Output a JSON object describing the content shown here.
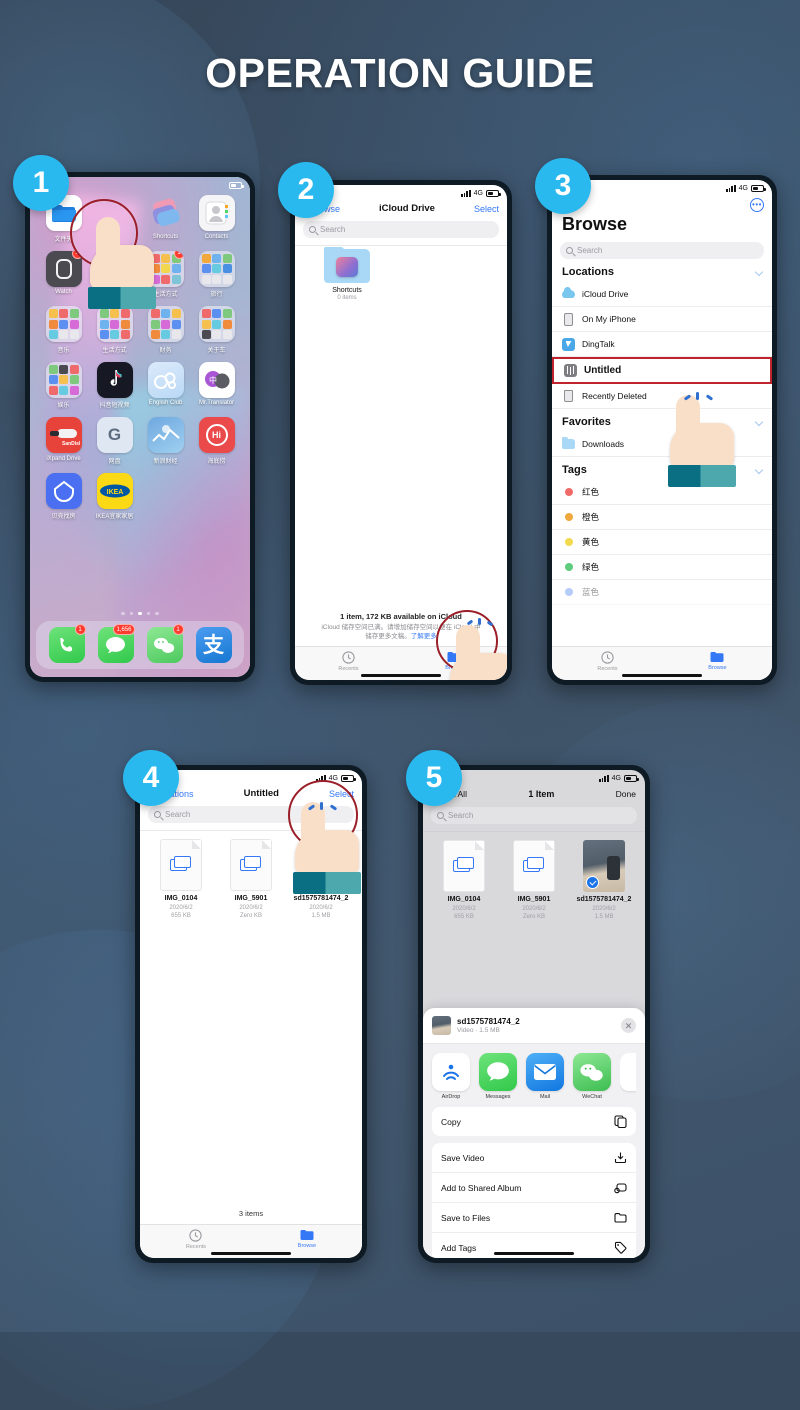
{
  "page": {
    "title": "OPERATION GUIDE",
    "accent": "#2ab9ef",
    "highlight": "#c0232b",
    "background": "#37495c"
  },
  "status_bar": {
    "network": "4G",
    "signal_icon": "signal-bars-icon",
    "battery_icon": "battery-icon"
  },
  "steps": [
    {
      "number": "1"
    },
    {
      "number": "2"
    },
    {
      "number": "3"
    },
    {
      "number": "4"
    },
    {
      "number": "5"
    }
  ],
  "step1": {
    "name": "home-screen",
    "apps": [
      {
        "label": "文件夹",
        "icon": "files-app-icon",
        "badge": ""
      },
      {
        "label": "",
        "icon": "blank",
        "badge": ""
      },
      {
        "label": "Shortcuts",
        "icon": "shortcuts-icon",
        "badge": ""
      },
      {
        "label": "Contacts",
        "icon": "contacts-icon",
        "badge": ""
      },
      {
        "label": "Watch",
        "icon": "watch-icon",
        "badge": "1"
      },
      {
        "label": "",
        "icon": "blank",
        "badge": "1"
      },
      {
        "label": "生活方式",
        "icon": "folder-icon",
        "badge": "1"
      },
      {
        "label": "旅行",
        "icon": "folder-icon",
        "badge": ""
      },
      {
        "label": "音乐",
        "icon": "folder-icon",
        "badge": ""
      },
      {
        "label": "生活方式",
        "icon": "folder-icon",
        "badge": ""
      },
      {
        "label": "财务",
        "icon": "folder-icon",
        "badge": ""
      },
      {
        "label": "关于车",
        "icon": "folder-icon",
        "badge": ""
      },
      {
        "label": "娱乐",
        "icon": "folder-icon",
        "badge": ""
      },
      {
        "label": "抖音短视频",
        "icon": "tiktok-icon",
        "badge": ""
      },
      {
        "label": "English Club",
        "icon": "english-club-icon",
        "badge": ""
      },
      {
        "label": "Mr.Translator",
        "icon": "translator-icon",
        "badge": ""
      },
      {
        "label": "iXpand Drive",
        "icon": "sandisk-ixpand-icon",
        "badge": ""
      },
      {
        "label": "网盘",
        "icon": "google-icon",
        "badge": ""
      },
      {
        "label": "新浪财经",
        "icon": "sina-finance-icon",
        "badge": ""
      },
      {
        "label": "海底捞",
        "icon": "haidilao-icon",
        "badge": ""
      },
      {
        "label": "贝壳找房",
        "icon": "beike-icon",
        "badge": ""
      },
      {
        "label": "IKEA宜家家居",
        "icon": "ikea-icon",
        "badge": ""
      }
    ],
    "page_dots": 5,
    "active_dot": 3,
    "dock": [
      {
        "label": "Phone",
        "icon": "phone-icon",
        "badge": "1"
      },
      {
        "label": "Messages",
        "icon": "messages-icon",
        "badge": "1,656"
      },
      {
        "label": "WeChat",
        "icon": "wechat-icon",
        "badge": "1"
      },
      {
        "label": "Alipay",
        "icon": "alipay-icon",
        "badge": ""
      }
    ]
  },
  "step2": {
    "name": "icloud-drive-screen",
    "nav": {
      "back": "Browse",
      "title": "iCloud Drive",
      "action": "Select"
    },
    "search_placeholder": "Search",
    "items": [
      {
        "name": "Shortcuts",
        "sub": "0 items",
        "icon": "folder-shortcuts-icon"
      }
    ],
    "footer_primary": "1 item, 172 KB available on iCloud",
    "footer_secondary_1": "iCloud 储存空间已满。请增加储存空间以便在 iCloud 中",
    "footer_secondary_2": "储存更多文稿。",
    "footer_link": "了解更多",
    "tabs": [
      {
        "label": "Recents",
        "icon": "clock-icon"
      },
      {
        "label": "Browse",
        "icon": "folder-icon"
      }
    ],
    "active_tab": "Browse"
  },
  "step3": {
    "name": "browse-screen",
    "more_button": "ellipsis-icon",
    "title": "Browse",
    "search_placeholder": "Search",
    "sections": [
      {
        "header": "Locations",
        "rows": [
          {
            "label": "iCloud Drive",
            "icon": "icloud-icon",
            "highlighted": false
          },
          {
            "label": "On My iPhone",
            "icon": "iphone-icon",
            "highlighted": false
          },
          {
            "label": "DingTalk",
            "icon": "dingtalk-icon",
            "highlighted": false
          },
          {
            "label": "Untitled",
            "icon": "usb-drive-icon",
            "highlighted": true
          },
          {
            "label": "Recently Deleted",
            "icon": "trash-icon",
            "highlighted": false
          }
        ]
      },
      {
        "header": "Favorites",
        "rows": [
          {
            "label": "Downloads",
            "icon": "downloads-folder-icon",
            "highlighted": false
          }
        ]
      },
      {
        "header": "Tags",
        "rows": [
          {
            "label": "红色",
            "icon": "tag-dot-icon",
            "color": "#f06a6a",
            "highlighted": false
          },
          {
            "label": "橙色",
            "icon": "tag-dot-icon",
            "color": "#f0a83c",
            "highlighted": false
          },
          {
            "label": "黄色",
            "icon": "tag-dot-icon",
            "color": "#f2d94e",
            "highlighted": false
          },
          {
            "label": "绿色",
            "icon": "tag-dot-icon",
            "color": "#5fcc7d",
            "highlighted": false
          },
          {
            "label": "蓝色",
            "icon": "tag-dot-icon",
            "color": "#5b8ff0",
            "highlighted": false
          }
        ]
      }
    ],
    "tabs": [
      {
        "label": "Recents",
        "icon": "clock-icon"
      },
      {
        "label": "Browse",
        "icon": "folder-icon"
      }
    ],
    "active_tab": "Browse"
  },
  "step4": {
    "name": "untitled-folder-screen",
    "nav": {
      "back": "Locations",
      "title": "Untitled",
      "action": "Select"
    },
    "search_placeholder": "Search",
    "files": [
      {
        "name": "IMG_0104",
        "date": "2020/6/2",
        "size": "655 KB",
        "icon": "document-icon",
        "selected": false
      },
      {
        "name": "IMG_5901",
        "date": "2020/6/2",
        "size": "Zero KB",
        "icon": "document-icon",
        "selected": false
      },
      {
        "name": "sd1575781474_2",
        "date": "2020/6/2",
        "size": "1.5 MB",
        "icon": "video-thumbnail-icon",
        "selected": false
      }
    ],
    "item_count": "3 items",
    "tabs": [
      {
        "label": "Recents",
        "icon": "clock-icon"
      },
      {
        "label": "Browse",
        "icon": "folder-icon"
      }
    ],
    "active_tab": "Browse"
  },
  "step5": {
    "name": "share-sheet-screen",
    "nav": {
      "back": "Select All",
      "title": "1 Item",
      "action": "Done"
    },
    "search_placeholder": "Search",
    "files": [
      {
        "name": "IMG_0104",
        "date": "2020/6/2",
        "size": "655 KB",
        "icon": "document-icon",
        "selected": false
      },
      {
        "name": "IMG_5901",
        "date": "2020/6/2",
        "size": "Zero KB",
        "icon": "document-icon",
        "selected": false
      },
      {
        "name": "sd1575781474_2",
        "date": "2020/6/2",
        "size": "1.5 MB",
        "icon": "video-thumbnail-icon",
        "selected": true
      }
    ],
    "sheet": {
      "file_name": "sd1575781474_2",
      "file_sub": "Video · 1.5 MB",
      "close_icon": "close-icon",
      "share_apps": [
        {
          "label": "AirDrop",
          "icon": "airdrop-icon"
        },
        {
          "label": "Messages",
          "icon": "messages-icon"
        },
        {
          "label": "Mail",
          "icon": "mail-icon"
        },
        {
          "label": "WeChat",
          "icon": "wechat-icon"
        }
      ],
      "actions_group_1": [
        {
          "label": "Copy",
          "icon": "copy-icon"
        }
      ],
      "actions_group_2": [
        {
          "label": "Save Video",
          "icon": "save-video-icon"
        },
        {
          "label": "Add to Shared Album",
          "icon": "shared-album-icon"
        },
        {
          "label": "Save to Files",
          "icon": "folder-icon"
        },
        {
          "label": "Add Tags",
          "icon": "tag-icon"
        }
      ]
    }
  }
}
